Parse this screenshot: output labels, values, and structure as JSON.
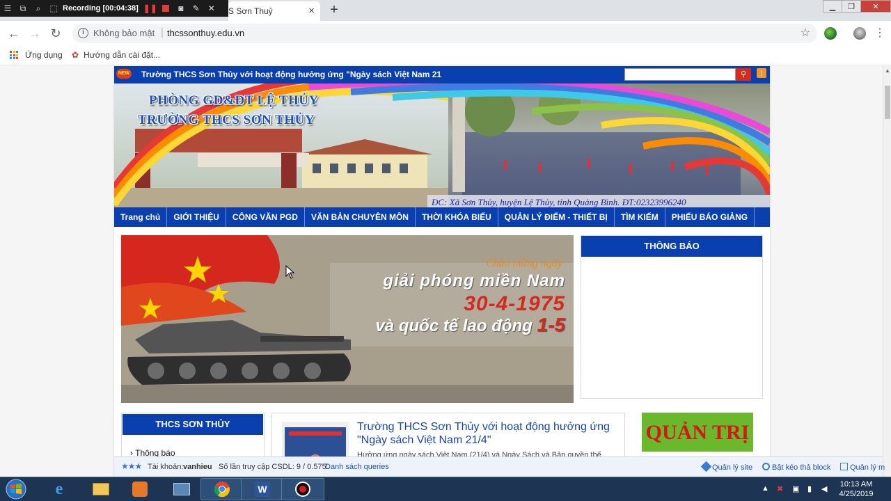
{
  "recorder": {
    "status": "Recording [00:04:38]"
  },
  "browser": {
    "tab_title": "S Sơn Thuỷ",
    "new_tab": "+",
    "security_label": "Không bảo mật",
    "url": "thcssonthuy.edu.vn",
    "bookmarks": [
      {
        "label": "Ứng dụng"
      },
      {
        "label": "Hướng dẫn cài đặt..."
      }
    ]
  },
  "site": {
    "ticker": "Trường THCS Sơn Thủy với hoạt động hưởng ứng \"Ngày sách Việt Nam 21",
    "new_badge": "NEW",
    "banner": {
      "line1": "PHÒNG GD&ĐT LỆ THỦY",
      "line2": "TRƯỜNG THCS SƠN THỦY",
      "address": "ĐC: Xã Sơn Thủy, huyện Lệ Thủy, tỉnh Quảng Bình. ĐT:02323996240"
    },
    "nav": [
      {
        "label": "Trang chủ"
      },
      {
        "label": "GIỚI THIỆU"
      },
      {
        "label": "CÔNG VĂN PGD"
      },
      {
        "label": "VĂN BẢN CHUYÊN MÔN"
      },
      {
        "label": "THỜI KHÓA BIỂU"
      },
      {
        "label": "QUẢN LÝ ĐIỂM - THIẾT BỊ"
      },
      {
        "label": "TÌM KIẾM"
      },
      {
        "label": "PHIẾU BÁO GIẢNG"
      }
    ],
    "slider": {
      "line1": "Chào mừng ngày",
      "line2": "giải phóng miền Nam",
      "line3": "30-4-1975",
      "line4_prefix": "và quốc tế lao động",
      "line4_date": "1-5"
    },
    "notice_title": "THÔNG BÁO",
    "left_box": {
      "title": "THCS SƠN THỦY",
      "item": "Thông báo"
    },
    "article": {
      "title": "Trường THCS Sơn Thủy với hoạt động hưởng ứng \"Ngày sách Việt Nam 21/4\"",
      "excerpt": "Hưởng ứng ngày sách Việt Nam (21/4) và Ngày Sách và Bản quyền thế"
    },
    "admin_button": "QUẢN TRỊ"
  },
  "admin_bar": {
    "account_label": "Tài khoản:",
    "username": "vanhieu",
    "db_stats": "Số lần truy cập CSDL: 9 / 0.575'.",
    "queries_link": "Danh sách queries",
    "manage_site": "Quản lý site",
    "drag_block": "Bật kéo thả block",
    "manage_more": "Quản lý m"
  },
  "taskbar": {
    "time": "10:13 AM",
    "date": "4/25/2019"
  },
  "colors": {
    "site_blue": "#0a3fb0",
    "admin_green": "#6ab82c",
    "admin_red": "#d71616"
  }
}
